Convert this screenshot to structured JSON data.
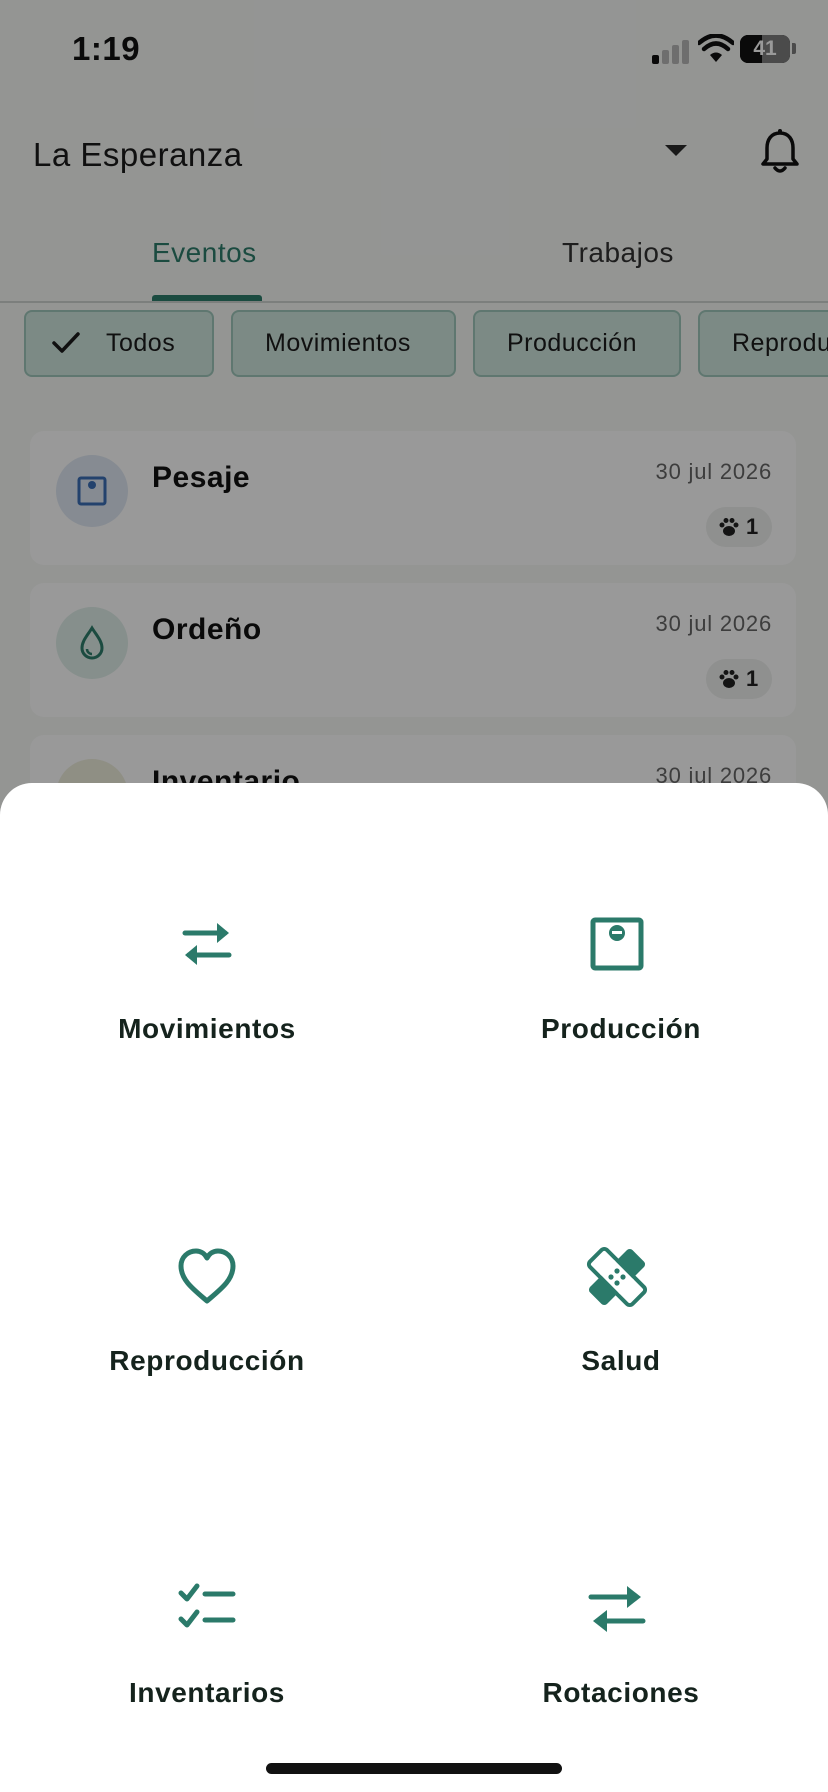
{
  "status_bar": {
    "time": "1:19",
    "battery": "41"
  },
  "header": {
    "farm_name": "La Esperanza"
  },
  "tabs": [
    {
      "label": "Eventos",
      "active": true
    },
    {
      "label": "Trabajos",
      "active": false
    }
  ],
  "filter_chips": [
    {
      "label": "Todos",
      "selected": true
    },
    {
      "label": "Movimientos"
    },
    {
      "label": "Producción"
    },
    {
      "label": "Reprodu"
    }
  ],
  "events": [
    {
      "title": "Pesaje",
      "date": "30 jul 2026",
      "animal_count": "1",
      "icon": "scale-icon"
    },
    {
      "title": "Ordeño",
      "date": "30 jul 2026",
      "animal_count": "1",
      "icon": "drop-icon"
    },
    {
      "title": "Inventario",
      "date": "30 jul 2026",
      "icon": "checklist-icon"
    }
  ],
  "sheet": {
    "options": [
      {
        "label": "Movimientos",
        "icon": "swap-arrows-icon"
      },
      {
        "label": "Producción",
        "icon": "scale-icon"
      },
      {
        "label": "Reproducción",
        "icon": "heart-icon"
      },
      {
        "label": "Salud",
        "icon": "bandage-icon"
      },
      {
        "label": "Inventarios",
        "icon": "checklist-icon"
      },
      {
        "label": "Rotaciones",
        "icon": "rotate-arrows-icon"
      }
    ]
  },
  "colors": {
    "accent": "#2e7d6b",
    "chip_bg": "#cfe6de",
    "sheet_icon": "#2b7a6a",
    "scrim": "rgba(0,0,0,0.40)"
  }
}
